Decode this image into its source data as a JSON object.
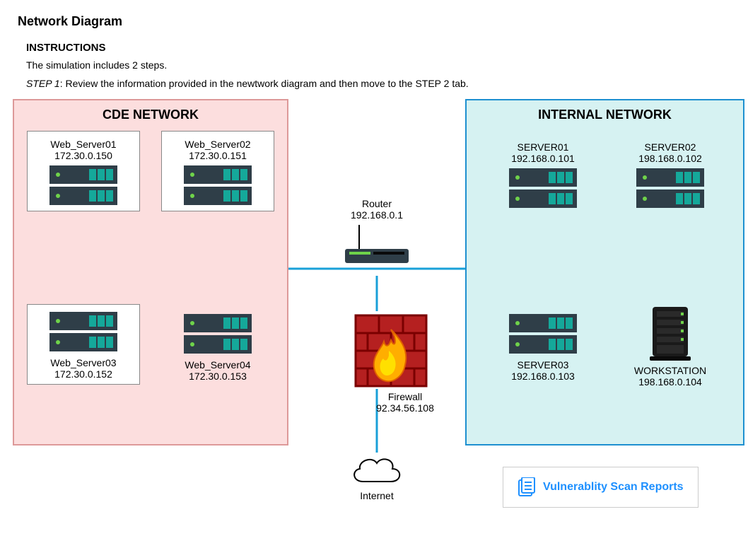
{
  "page": {
    "title": "Network Diagram",
    "instructions_heading": "INSTRUCTIONS",
    "instructions_text": "The simulation includes 2 steps.",
    "step1_label": "STEP 1",
    "step1_text": ": Review the information provided in the newtwork diagram and then move to the STEP 2 tab."
  },
  "zones": {
    "cde_title": "CDE NETWORK",
    "internal_title": "INTERNAL NETWORK"
  },
  "cde_nodes": {
    "ws1": {
      "name": "Web_Server01",
      "ip": "172.30.0.150"
    },
    "ws2": {
      "name": "Web_Server02",
      "ip": "172.30.0.151"
    },
    "ws3": {
      "name": "Web_Server03",
      "ip": "172.30.0.152"
    },
    "ws4": {
      "name": "Web_Server04",
      "ip": "172.30.0.153"
    }
  },
  "internal_nodes": {
    "s1": {
      "name": "SERVER01",
      "ip": "192.168.0.101"
    },
    "s2": {
      "name": "SERVER02",
      "ip": "198.168.0.102"
    },
    "s3": {
      "name": "SERVER03",
      "ip": "192.168.0.103"
    },
    "wk": {
      "name": "WORKSTATION",
      "ip": "198.168.0.104"
    }
  },
  "center": {
    "router_name": "Router",
    "router_ip": "192.168.0.1",
    "firewall_name": "Firewall",
    "firewall_ip": "92.34.56.108",
    "internet_name": "Internet"
  },
  "button": {
    "vuln_reports": "Vulnerablity Scan Reports"
  }
}
